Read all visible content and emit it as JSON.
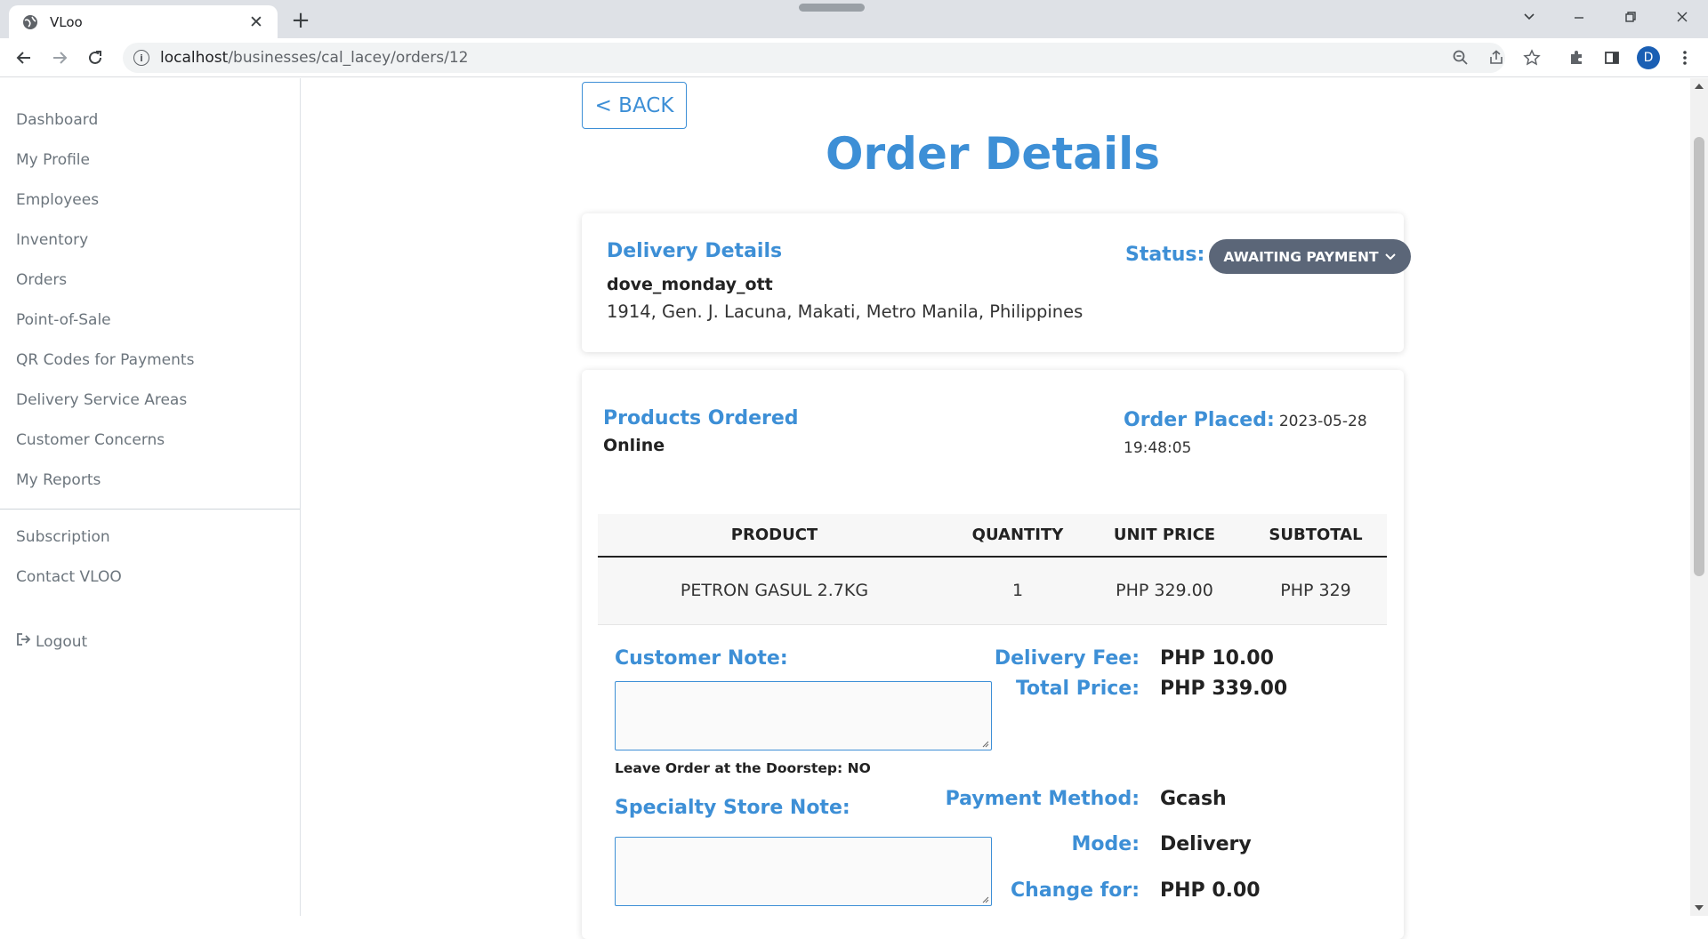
{
  "browser": {
    "tab_title": "VLoo",
    "url_host": "localhost",
    "url_path": "/businesses/cal_lacey/orders/12",
    "profile_initial": "D"
  },
  "sidebar": {
    "items": [
      {
        "label": "Dashboard"
      },
      {
        "label": "My Profile"
      },
      {
        "label": "Employees"
      },
      {
        "label": "Inventory"
      },
      {
        "label": "Orders"
      },
      {
        "label": "Point-of-Sale"
      },
      {
        "label": "QR Codes for Payments"
      },
      {
        "label": "Delivery Service Areas"
      },
      {
        "label": "Customer Concerns"
      },
      {
        "label": "My Reports"
      }
    ],
    "secondary": [
      {
        "label": "Subscription"
      },
      {
        "label": "Contact VLOO"
      }
    ],
    "logout_label": "Logout"
  },
  "page": {
    "back_label": "< BACK",
    "title": "Order Details"
  },
  "delivery": {
    "heading": "Delivery Details",
    "username": "dove_monday_ott",
    "address": "1914, Gen. J. Lacuna, Makati, Metro Manila, Philippines",
    "status_label": "Status:",
    "status_value": "AWAITING PAYMENT"
  },
  "order": {
    "products_heading": "Products Ordered",
    "channel": "Online",
    "placed_label": "Order Placed:",
    "placed_date": "2023-05-28",
    "placed_time": "19:48:05",
    "columns": [
      "PRODUCT",
      "QUANTITY",
      "UNIT PRICE",
      "SUBTOTAL"
    ],
    "rows": [
      {
        "product": "PETRON GASUL 2.7KG",
        "quantity": "1",
        "unit_price": "PHP 329.00",
        "subtotal": "PHP 329"
      }
    ]
  },
  "notes": {
    "customer_note_label": "Customer Note:",
    "customer_note_value": "",
    "doorstep_text": "Leave Order at the Doorstep: NO",
    "store_note_label": "Specialty Store Note:",
    "store_note_value": ""
  },
  "summary": {
    "delivery_fee_label": "Delivery Fee:",
    "delivery_fee": "PHP 10.00",
    "total_label": "Total Price:",
    "total": "PHP 339.00",
    "payment_label": "Payment Method:",
    "payment": "Gcash",
    "mode_label": "Mode:",
    "mode": "Delivery",
    "change_label": "Change for:",
    "change": "PHP 0.00"
  }
}
